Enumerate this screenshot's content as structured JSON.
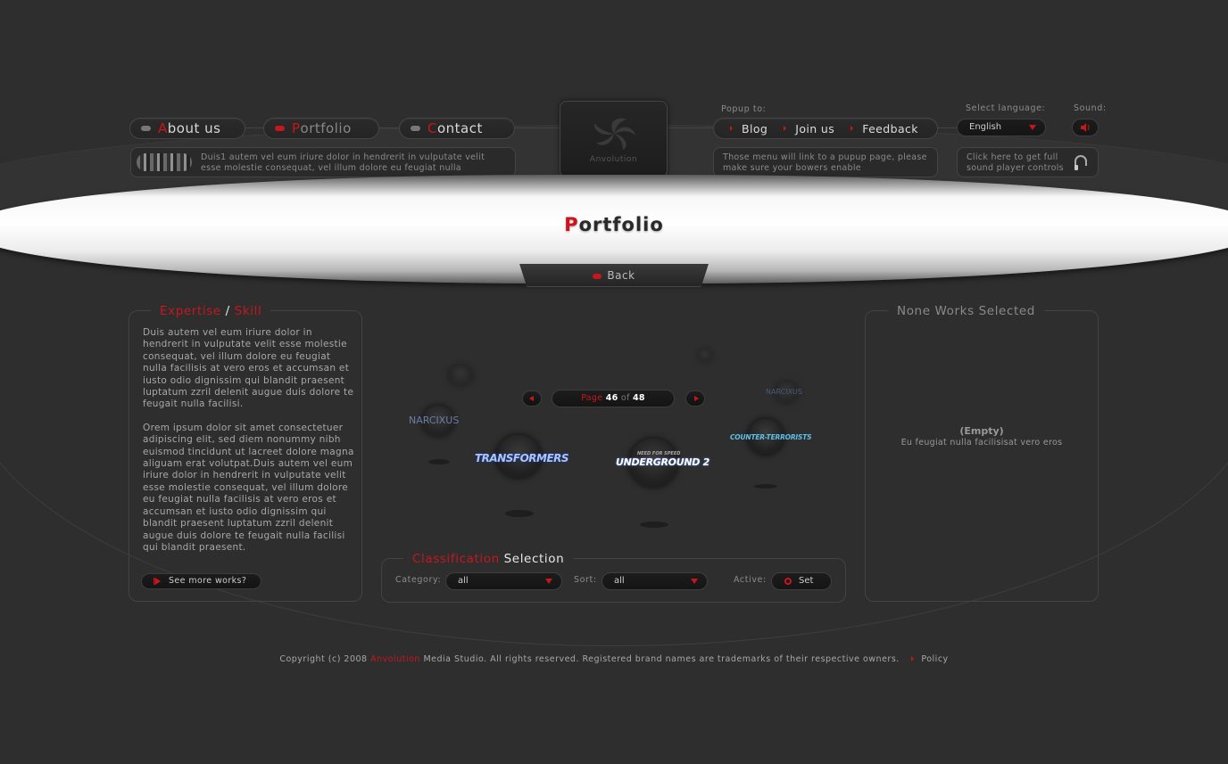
{
  "nav": {
    "items": [
      {
        "initial": "A",
        "rest": "bout us",
        "active": false
      },
      {
        "initial": "P",
        "rest": "ortfolio",
        "active": true
      },
      {
        "initial": "C",
        "rest": "ontact",
        "active": false
      }
    ],
    "news_text": "Duis1 autem vel eum iriure dolor in hendrerit in vulputate velit esse molestie consequat, vel illum dolore eu feugiat nulla"
  },
  "logo": {
    "text": "Anvolution"
  },
  "popup": {
    "label": "Popup to:",
    "items": [
      "Blog",
      "Join us",
      "Feedback"
    ],
    "note": "Those menu will link to a pupup page, please make sure your bowers enable"
  },
  "language": {
    "label": "Select language:",
    "selected": "English"
  },
  "sound": {
    "label": "Sound:",
    "note": "Click here to get full sound player controls"
  },
  "page": {
    "title_initial": "P",
    "title_rest": "ortfolio",
    "back_label": "Back"
  },
  "expertise": {
    "title_a": "Expertise",
    "title_sep": " / ",
    "title_b": "Skill",
    "para1": "Duis autem vel eum iriure dolor in hendrerit in vulputate velit esse molestie consequat, vel illum dolore eu feugiat nulla facilisis at vero eros et accumsan et iusto odio dignissim qui blandit praesent luptatum zzril delenit augue duis dolore te feugait nulla facilisi.",
    "para2": "Orem ipsum dolor sit amet consectetuer adipiscing elit, sed diem nonummy nibh euismod tincidunt ut lacreet dolore magna aliguam erat volutpat.Duis autem vel eum iriure dolor in hendrerit in vulputate velit esse molestie consequat, vel illum dolore eu feugiat nulla facilisis at vero eros et accumsan et iusto odio dignissim qui blandit praesent luptatum zzril delenit augue duis dolore te feugait nulla facilisi qui blandit praesent.",
    "button": "See more works?"
  },
  "carousel": {
    "page_word": "Page",
    "current": "46",
    "of_word": "of",
    "total": "48",
    "items": [
      "NARCIXUS",
      "TRANSFORMERS",
      "UNDERGROUND 2",
      "COUNTER-TERRORISTS",
      "NARCIXUS"
    ],
    "ug_top": "NEED FOR SPEED"
  },
  "classification": {
    "title_a": "Classification",
    "title_b": " Selection",
    "category_label": "Category:",
    "category_value": "all",
    "sort_label": "Sort:",
    "sort_value": "all",
    "active_label": "Active:",
    "set_label": "Set"
  },
  "works": {
    "title": "None Works Selected",
    "empty": "(Empty)",
    "empty_sub": "Eu feugiat nulla facilisisat vero eros"
  },
  "footer": {
    "prefix": "Copyright (c) 2008 ",
    "brand": "Anvolution",
    "suffix": " Media Studio. All rights reserved. Registered brand names are trademarks of their respective owners.",
    "policy": "Policy"
  },
  "colors": {
    "accent": "#c8161c",
    "background": "#2e2e2e"
  }
}
